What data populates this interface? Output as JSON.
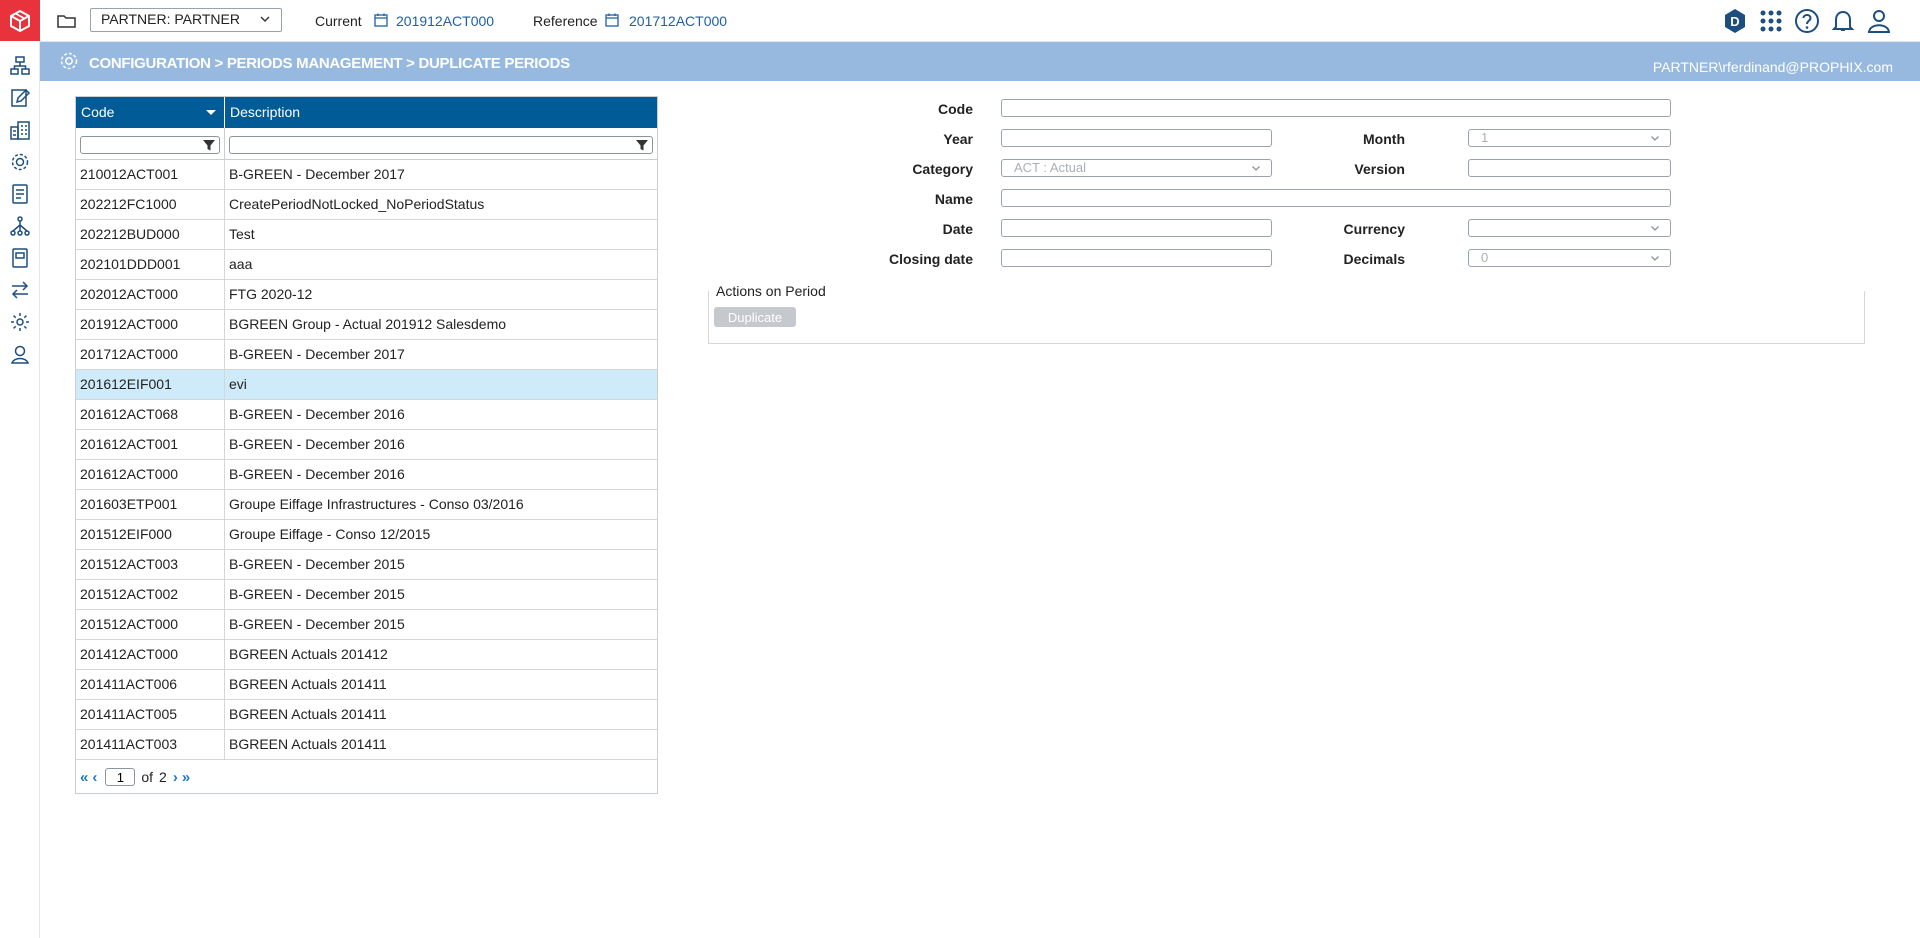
{
  "topbar": {
    "context_select_value": "PARTNER: PARTNER",
    "current_label": "Current",
    "current_value": "201912ACT000",
    "reference_label": "Reference",
    "reference_value": "201712ACT000",
    "domain_badge": "D"
  },
  "band": {
    "breadcrumb": "CONFIGURATION > PERIODS MANAGEMENT > DUPLICATE PERIODS",
    "user": "PARTNER\\rferdinand@PROPHIX.com"
  },
  "grid": {
    "columns": [
      "Code",
      "Description"
    ],
    "rows": [
      {
        "code": "210012ACT001",
        "desc": "B-GREEN - December 2017"
      },
      {
        "code": "202212FC1000",
        "desc": "CreatePeriodNotLocked_NoPeriodStatus"
      },
      {
        "code": "202212BUD000",
        "desc": "Test"
      },
      {
        "code": "202101DDD001",
        "desc": "aaa"
      },
      {
        "code": "202012ACT000",
        "desc": "FTG 2020-12"
      },
      {
        "code": "201912ACT000",
        "desc": "BGREEN Group - Actual 201912 Salesdemo"
      },
      {
        "code": "201712ACT000",
        "desc": "B-GREEN - December 2017"
      },
      {
        "code": "201612EIF001",
        "desc": "evi"
      },
      {
        "code": "201612ACT068",
        "desc": "B-GREEN - December 2016"
      },
      {
        "code": "201612ACT001",
        "desc": "B-GREEN - December 2016"
      },
      {
        "code": "201612ACT000",
        "desc": "B-GREEN - December 2016"
      },
      {
        "code": "201603ETP001",
        "desc": "Groupe Eiffage Infrastructures - Conso 03/2016"
      },
      {
        "code": "201512EIF000",
        "desc": "Groupe Eiffage - Conso 12/2015"
      },
      {
        "code": "201512ACT003",
        "desc": "B-GREEN - December 2015"
      },
      {
        "code": "201512ACT002",
        "desc": "B-GREEN - December 2015"
      },
      {
        "code": "201512ACT000",
        "desc": "B-GREEN - December 2015"
      },
      {
        "code": "201412ACT000",
        "desc": "BGREEN Actuals 201412"
      },
      {
        "code": "201411ACT006",
        "desc": "BGREEN Actuals 201411"
      },
      {
        "code": "201411ACT005",
        "desc": "BGREEN Actuals 201411"
      },
      {
        "code": "201411ACT003",
        "desc": "BGREEN Actuals 201411"
      }
    ],
    "selected_index": 7,
    "pager": {
      "current_page": "1",
      "of_label": "of",
      "total_pages": "2"
    }
  },
  "form": {
    "code_label": "Code",
    "year_label": "Year",
    "month_label": "Month",
    "month_value": "1",
    "category_label": "Category",
    "category_value": "ACT : Actual",
    "version_label": "Version",
    "name_label": "Name",
    "date_label": "Date",
    "currency_label": "Currency",
    "closing_date_label": "Closing date",
    "decimals_label": "Decimals",
    "decimals_value": "0",
    "actions_title": "Actions on Period",
    "duplicate_label": "Duplicate"
  },
  "colors": {
    "logo": "#e8323c",
    "band": "#97b9df",
    "grid_header": "#005b96",
    "selected_row": "#cfeaf9",
    "link": "#1e5fa6"
  }
}
